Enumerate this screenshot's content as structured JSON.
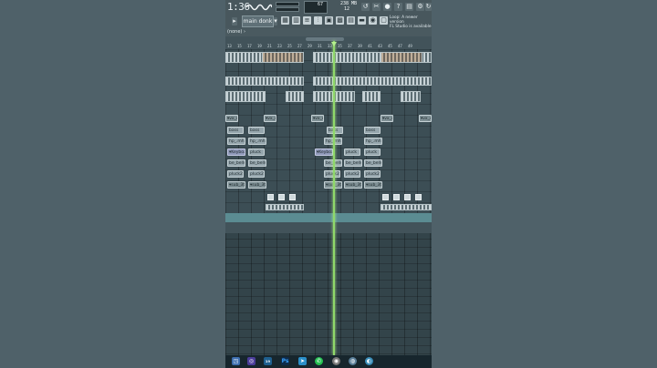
{
  "toolbar": {
    "time": "1:36",
    "tempo": "67",
    "memory": "238 MB",
    "cpu": "12",
    "pattern": "main donk",
    "hint_line1": "Loop: A newer version",
    "hint_line2": "FL Studio is available"
  },
  "breadcrumb": "(none) ›",
  "ruler_ticks": [
    "13",
    "15",
    "17",
    "19",
    "21",
    "23",
    "25",
    "27",
    "29",
    "31",
    "33",
    "35",
    "37",
    "39",
    "41",
    "43",
    "45",
    "47",
    "49"
  ],
  "clips": {
    "voxcp": "▾vx_cp_1",
    "bass": "bass",
    "hat": "hp_.mh",
    "arp": "▾Keyboard",
    "pluck": "pluck",
    "bell": "be_bells",
    "pluck2": "pluck2",
    "sub": "▾sub_3th"
  },
  "taskbar_icons": [
    "start-icon",
    "cortana-icon",
    "fl-icon",
    "photoshop-icon",
    "telegram-icon",
    "whatsapp-icon",
    "chrome-icon",
    "browser-icon",
    "edge-icon"
  ]
}
